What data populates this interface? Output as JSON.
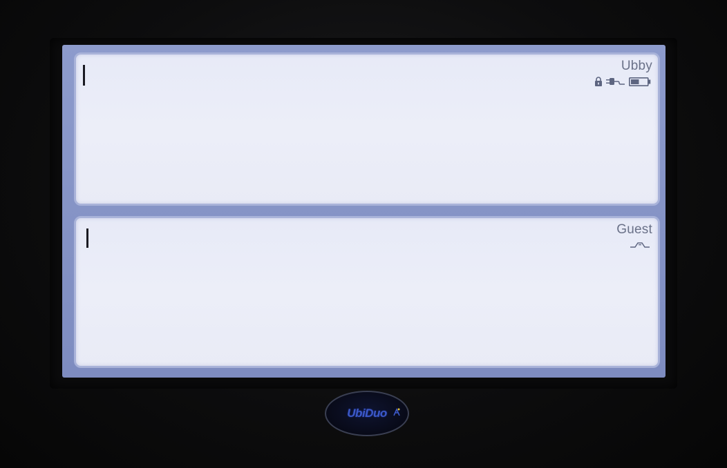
{
  "colors": {
    "screen_backlight": "#eceef8",
    "panel_border": "#a9b3d9",
    "label_text": "#6a7188",
    "icon_color": "#5d6580",
    "logo_blue": "#3c59c9"
  },
  "top_panel": {
    "user_label": "Ubby",
    "status_icons": [
      "lock-icon",
      "plug-icon",
      "battery-icon"
    ],
    "battery_level": 0.5,
    "text": ""
  },
  "bottom_panel": {
    "user_label": "Guest",
    "status_icons": [
      "keyboard-icon"
    ],
    "text": ""
  },
  "logo": {
    "brand": "UbiDuo"
  }
}
